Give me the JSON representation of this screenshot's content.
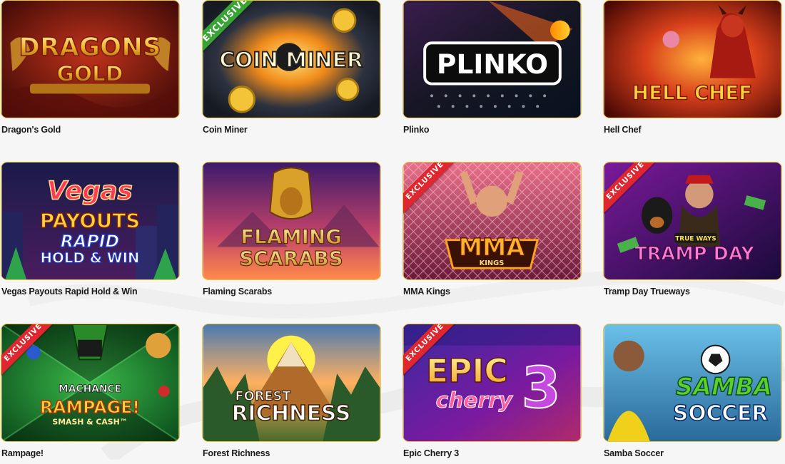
{
  "exclusive_label": "EXCLUSIVE",
  "games": [
    {
      "name": "Dragon's Gold",
      "logo_line1": "DRAGONS",
      "logo_line2": "GOLD",
      "exclusive": false
    },
    {
      "name": "Coin Miner",
      "logo_line1": "COIN MINER",
      "logo_line2": "",
      "exclusive": true
    },
    {
      "name": "Plinko",
      "logo_line1": "PLINKO",
      "logo_line2": "",
      "exclusive": false
    },
    {
      "name": "Hell Chef",
      "logo_line1": "HELL CHEF",
      "logo_line2": "",
      "exclusive": false
    },
    {
      "name": "Vegas Payouts Rapid Hold & Win",
      "logo_line1": "Vegas",
      "logo_line2": "PAYOUTS",
      "logo_line3": "RAPID",
      "logo_line4": "HOLD & WIN",
      "exclusive": false
    },
    {
      "name": "Flaming Scarabs",
      "logo_line1": "FLAMING",
      "logo_line2": "SCARABS",
      "exclusive": false
    },
    {
      "name": "MMA Kings",
      "logo_line1": "MMA",
      "logo_line2": "KINGS",
      "exclusive": true
    },
    {
      "name": "Tramp Day Trueways",
      "logo_line1": "TRUE WAYS",
      "logo_line2": "TRAMP DAY",
      "exclusive": true
    },
    {
      "name": "Rampage!",
      "logo_line1": "MACHANCE",
      "logo_line2": "RAMPAGE!",
      "logo_line3": "SMASH & CASH™",
      "exclusive": true
    },
    {
      "name": "Forest Richness",
      "logo_line1": "FOREST",
      "logo_line2": "RICHNESS",
      "exclusive": false
    },
    {
      "name": "Epic Cherry 3",
      "logo_line1": "EPIC",
      "logo_line2": "cherry",
      "logo_line3": "3",
      "exclusive": true
    },
    {
      "name": "Samba Soccer",
      "logo_line1": "SAMBA",
      "logo_line2": "SOCCER",
      "exclusive": false
    }
  ],
  "colors": {
    "tile_border": "#e8c33a",
    "exclusive_red": "#e0262f",
    "exclusive_green": "#3aa336",
    "page_background": "#f6f6f6",
    "caption_text": "#1a1a1a"
  }
}
